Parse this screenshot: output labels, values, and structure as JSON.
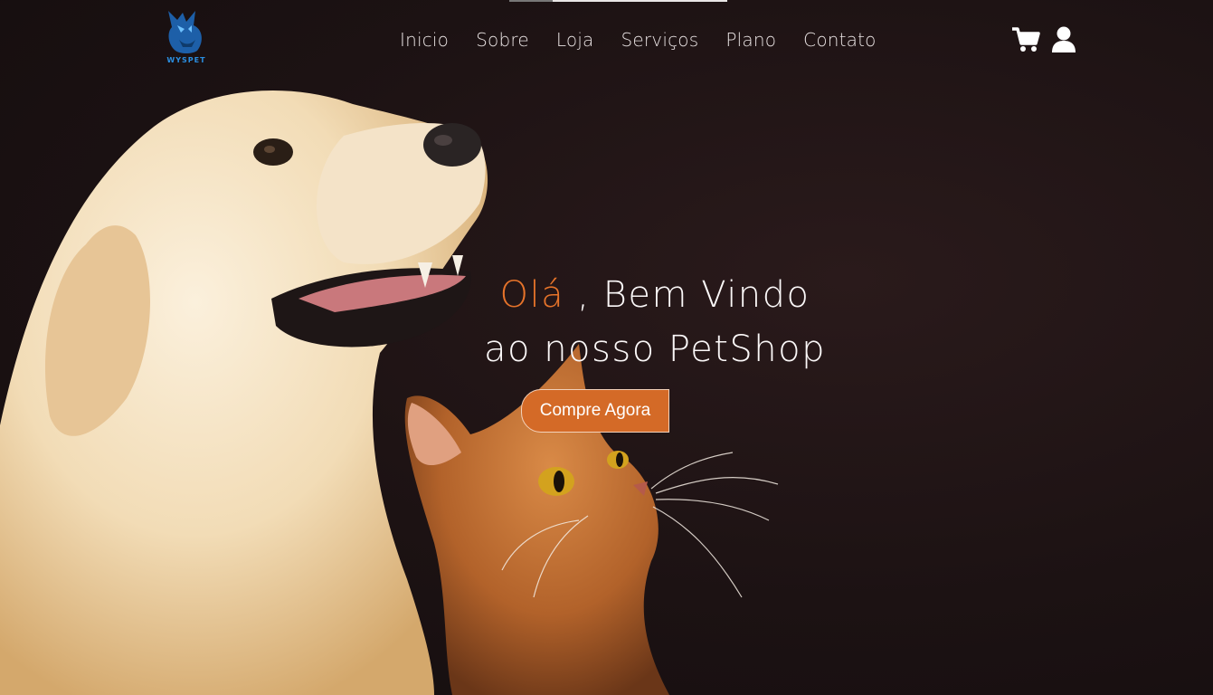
{
  "brand": {
    "logo_text": "WYSPET"
  },
  "nav": {
    "items": [
      {
        "label": "Inicio"
      },
      {
        "label": "Sobre"
      },
      {
        "label": "Loja"
      },
      {
        "label": "Serviços"
      },
      {
        "label": "Plano"
      },
      {
        "label": "Contato"
      }
    ]
  },
  "header_icons": {
    "cart": "shopping-cart-icon",
    "user": "user-icon"
  },
  "hero": {
    "greeting": "Olá",
    "line1_rest": " , Bem Vindo",
    "line2": "ao nosso PetShop",
    "cta_label": "Compre Agora"
  },
  "colors": {
    "accent": "#e6732a",
    "button": "#d46a27",
    "logo": "#2a8ee0",
    "background": "#1c1213"
  }
}
